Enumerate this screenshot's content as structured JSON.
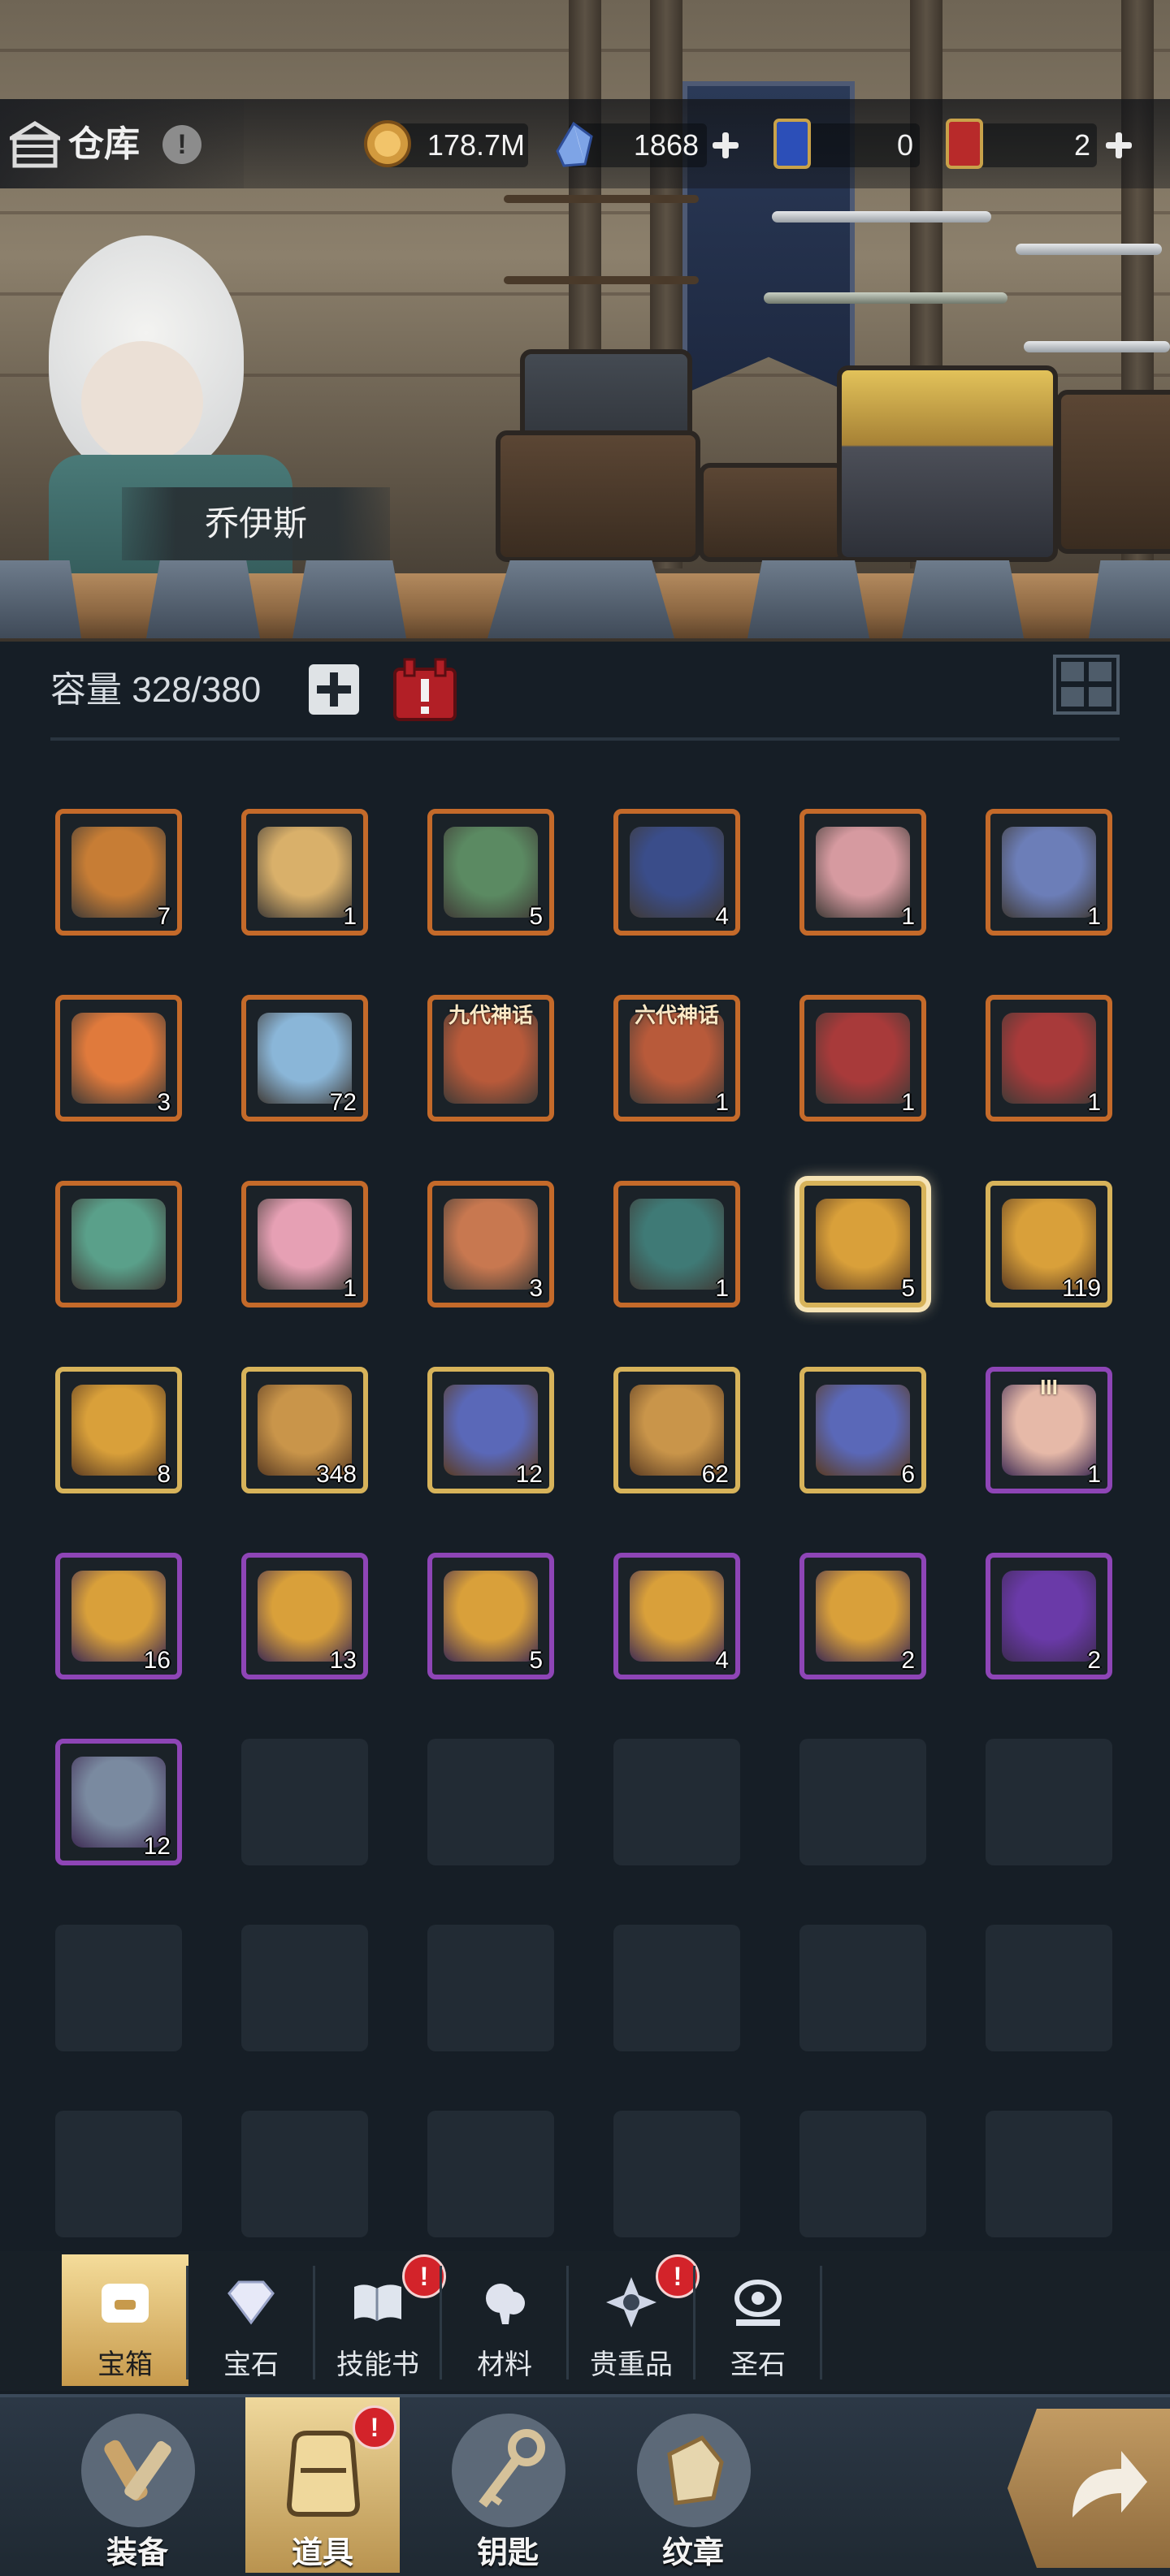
{
  "header": {
    "title": "仓库",
    "resources": {
      "gold": "178.7M",
      "crystal": "1868",
      "ticket_blue": "0",
      "ticket_red": "2"
    },
    "hero_name": "乔伊斯",
    "hero_icon": "npc-portrait"
  },
  "capacity": {
    "label": "容量 328/380",
    "used": 328,
    "total": 380
  },
  "inventory": [
    {
      "name": "black-gold-chest",
      "count": "7",
      "rarity": "orange"
    },
    {
      "name": "cloud-chest",
      "count": "1",
      "rarity": "orange"
    },
    {
      "name": "green-horned-chest",
      "count": "5",
      "rarity": "orange"
    },
    {
      "name": "navy-star-chest",
      "count": "4",
      "rarity": "orange"
    },
    {
      "name": "pink-jewel-chest",
      "count": "1",
      "rarity": "orange"
    },
    {
      "name": "moon-chest",
      "count": "1",
      "rarity": "orange"
    },
    {
      "name": "flame-chest",
      "count": "3",
      "rarity": "orange"
    },
    {
      "name": "pet-egg-bag",
      "count": "72",
      "rarity": "orange"
    },
    {
      "name": "myth-urn-9",
      "count": "",
      "rarity": "orange",
      "text": "九代神话"
    },
    {
      "name": "myth-urn-6",
      "count": "1",
      "rarity": "orange",
      "text": "六代神话"
    },
    {
      "name": "red-chest-a",
      "count": "1",
      "rarity": "orange"
    },
    {
      "name": "red-chest-b",
      "count": "1",
      "rarity": "orange"
    },
    {
      "name": "green-backpack",
      "count": "",
      "rarity": "orange"
    },
    {
      "name": "pink-backpack",
      "count": "1",
      "rarity": "orange"
    },
    {
      "name": "copper-urn",
      "count": "3",
      "rarity": "orange"
    },
    {
      "name": "teal-gold-chest",
      "count": "1",
      "rarity": "orange"
    },
    {
      "name": "gold-bag-selected",
      "count": "5",
      "rarity": "gold"
    },
    {
      "name": "gold-bag",
      "count": "119",
      "rarity": "gold"
    },
    {
      "name": "gold-bag-small",
      "count": "8",
      "rarity": "gold"
    },
    {
      "name": "gold-urn",
      "count": "348",
      "rarity": "gold"
    },
    {
      "name": "blue-urn",
      "count": "12",
      "rarity": "gold"
    },
    {
      "name": "gold-urn-b",
      "count": "62",
      "rarity": "gold"
    },
    {
      "name": "blue-urn-b",
      "count": "6",
      "rarity": "gold"
    },
    {
      "name": "tier3-pouch",
      "count": "1",
      "rarity": "purple",
      "text": "III"
    },
    {
      "name": "gold-bag-purple-a",
      "count": "16",
      "rarity": "purple"
    },
    {
      "name": "gold-bag-purple-b",
      "count": "13",
      "rarity": "purple"
    },
    {
      "name": "gold-bag-purple-c",
      "count": "5",
      "rarity": "purple"
    },
    {
      "name": "gold-bag-purple-d",
      "count": "4",
      "rarity": "purple"
    },
    {
      "name": "gold-bag-purple-e",
      "count": "2",
      "rarity": "purple"
    },
    {
      "name": "purple-crystal-chest",
      "count": "2",
      "rarity": "purple"
    },
    {
      "name": "steel-urn",
      "count": "12",
      "rarity": "purple"
    }
  ],
  "rarity_colors": {
    "orange": "#c46a2a",
    "gold": "#d7b35a",
    "purple": "#8e45b6"
  },
  "category_tabs": [
    {
      "label": "宝箱",
      "icon": "chest-icon",
      "active": true,
      "badge": ""
    },
    {
      "label": "宝石",
      "icon": "diamond-icon",
      "active": false,
      "badge": ""
    },
    {
      "label": "技能书",
      "icon": "book-icon",
      "active": false,
      "badge": "!"
    },
    {
      "label": "材料",
      "icon": "material-icon",
      "active": false,
      "badge": ""
    },
    {
      "label": "贵重品",
      "icon": "star-gem-icon",
      "active": false,
      "badge": "!"
    },
    {
      "label": "圣石",
      "icon": "holy-stone-icon",
      "active": false,
      "badge": ""
    }
  ],
  "nav": [
    {
      "label": "装备",
      "icon": "equipment-icon",
      "active": false,
      "badge": ""
    },
    {
      "label": "道具",
      "icon": "item-bag-icon",
      "active": true,
      "badge": "!"
    },
    {
      "label": "钥匙",
      "icon": "key-icon",
      "active": false,
      "badge": ""
    },
    {
      "label": "纹章",
      "icon": "emblem-icon",
      "active": false,
      "badge": ""
    }
  ]
}
